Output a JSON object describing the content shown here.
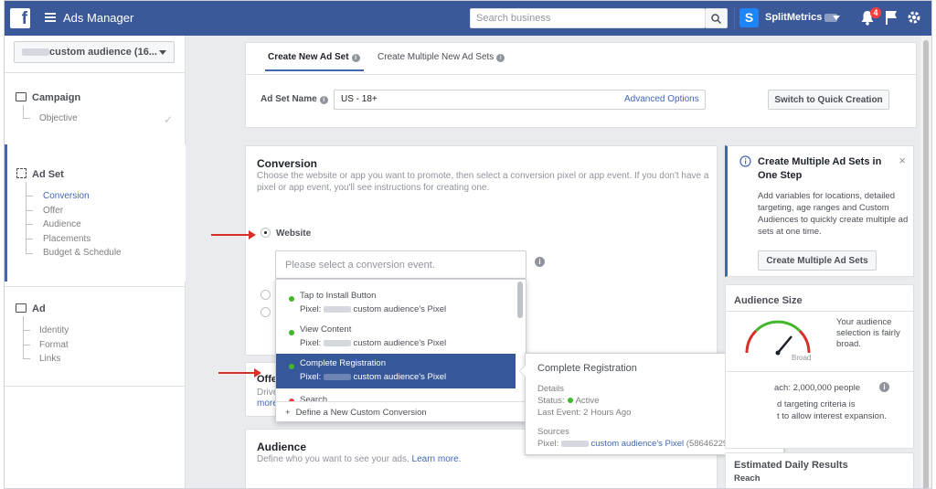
{
  "topbar": {
    "app_title": "Ads Manager",
    "search_placeholder": "Search business",
    "account_name": "SplitMetrics",
    "notifications_count": "4"
  },
  "sidebar": {
    "account_selector": "custom audience (16...",
    "campaign": {
      "label": "Campaign",
      "items": [
        "Objective"
      ]
    },
    "adset": {
      "label": "Ad Set",
      "items": [
        "Conversion",
        "Offer",
        "Audience",
        "Placements",
        "Budget & Schedule"
      ]
    },
    "ad": {
      "label": "Ad",
      "items": [
        "Identity",
        "Format",
        "Links"
      ]
    }
  },
  "tabs": {
    "create_new": "Create New Ad Set",
    "create_multiple": "Create Multiple New Ad Sets"
  },
  "adset_name": {
    "label": "Ad Set Name",
    "value": "US - 18+",
    "advanced": "Advanced Options",
    "switch_button": "Switch to Quick Creation"
  },
  "conversion": {
    "title": "Conversion",
    "description": "Choose the website or app you want to promote, then select a conversion pixel or app event. If you don't have a pixel or app event, you'll see instructions for creating one.",
    "website_label": "Website",
    "event_placeholder": "Please select a conversion event."
  },
  "dropdown": {
    "items": [
      {
        "title": "Tap to Install Button",
        "pixel_prefix": "Pixel:",
        "pixel_suffix": "custom audience's Pixel"
      },
      {
        "title": "View Content",
        "pixel_prefix": "Pixel:",
        "pixel_suffix": "custom audience's Pixel"
      },
      {
        "title": "Complete Registration",
        "pixel_prefix": "Pixel:",
        "pixel_suffix": "custom audience's Pixel"
      },
      {
        "title": "Search"
      }
    ],
    "footer": "Define a New Custom Conversion"
  },
  "offer": {
    "title_partial": "Offe",
    "desc_partial": "Drive",
    "more_partial": "more"
  },
  "tooltip": {
    "title": "Complete Registration",
    "details_heading": "Details",
    "status_label": "Status:",
    "status_value": "Active",
    "last_event": "Last Event: 2 Hours Ago",
    "sources_heading": "Sources",
    "pixel_prefix": "Pixel:",
    "pixel_link": "custom audience's Pixel",
    "pixel_id": "(58646229"
  },
  "audience": {
    "title": "Audience",
    "description": "Define who you want to see your ads.",
    "learn_more": "Learn more."
  },
  "multi_card": {
    "title": "Create Multiple Ad Sets in One Step",
    "body": "Add variables for locations, detailed targeting, age ranges and Custom Audiences to quickly create multiple ad sets at one time.",
    "button": "Create Multiple Ad Sets"
  },
  "audience_size": {
    "title": "Audience Size",
    "broad_label": "Broad",
    "text": "Your audience selection is fairly broad.",
    "reach_partial": "ach: 2,000,000 people",
    "targeting_line1": "d targeting criteria is",
    "targeting_line2": "t to allow interest expansion."
  },
  "daily_results": {
    "title": "Estimated Daily Results",
    "reach_label": "Reach"
  },
  "colors": {
    "brand": "#3b5998",
    "link": "#4267b2",
    "highlight": "#365899",
    "arrow": "#d63028",
    "active_dot": "#42b72a"
  }
}
